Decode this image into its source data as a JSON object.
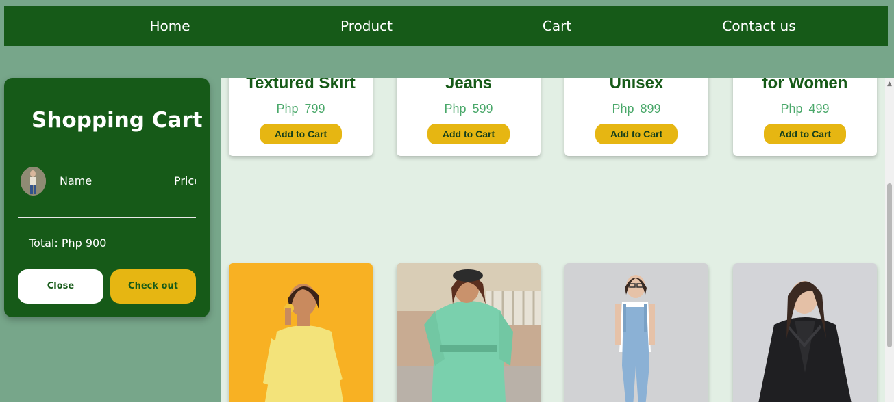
{
  "nav": {
    "home": "Home",
    "product": "Product",
    "cart": "Cart",
    "contact": "Contact us"
  },
  "products": [
    {
      "name": "Black & White Textured Skirt",
      "price": "Php 799",
      "button": "Add to Cart"
    },
    {
      "name": "Blue Denim Jeans",
      "price": "Php 599",
      "button": "Add to Cart"
    },
    {
      "name": "Grey Sweater Unisex",
      "price": "Php 899",
      "button": "Add to Cart"
    },
    {
      "name": "Sleeveless Dress for Women",
      "price": "Php 499",
      "button": "Add to Cart"
    }
  ],
  "cart": {
    "title": "Shopping Cart",
    "col_name": "Name",
    "col_price": "Price",
    "total": "Total: Php 900",
    "close": "Close",
    "checkout": "Check out"
  },
  "colors": {
    "primary_green": "#165a18",
    "page_bg": "#77a68a",
    "content_bg": "#e2efe4",
    "accent_yellow": "#e6b612",
    "price_green": "#4aa86a"
  }
}
